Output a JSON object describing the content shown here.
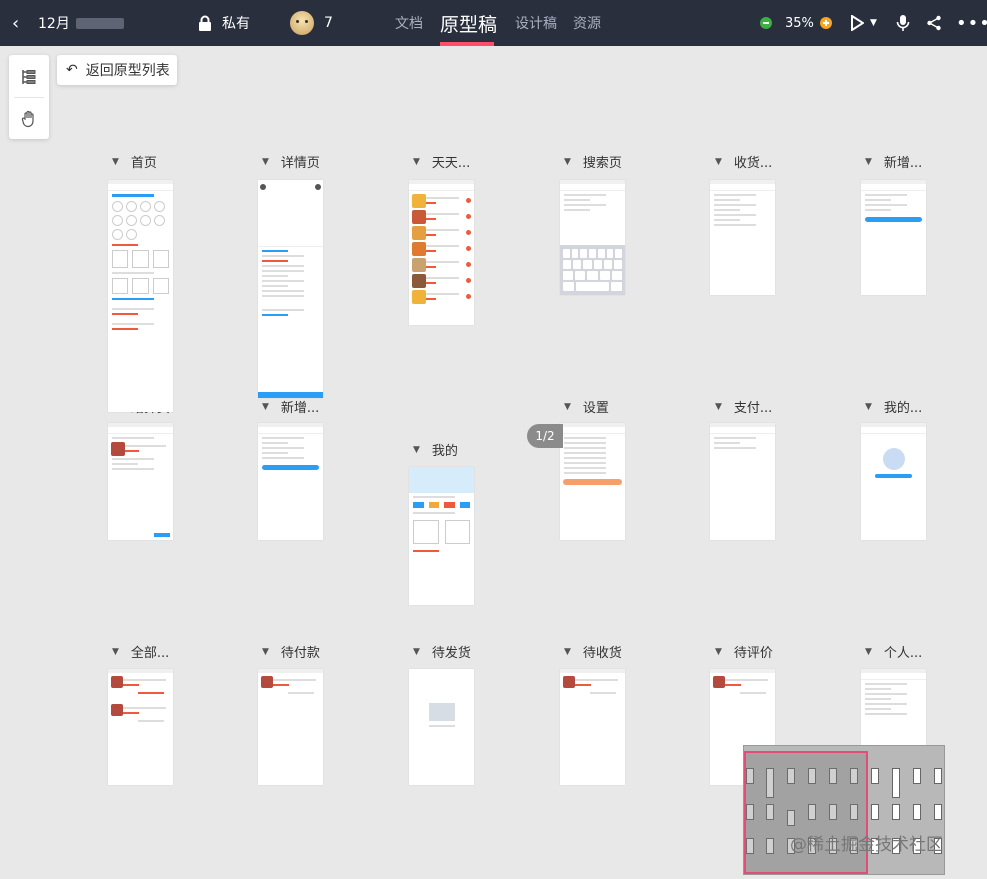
{
  "header": {
    "back_icon": "chevron-left-icon",
    "project_title": "12月",
    "privacy_label": "私有",
    "member_count": "7",
    "tabs": [
      {
        "label": "文档",
        "active": false
      },
      {
        "label": "原型稿",
        "active": true
      },
      {
        "label": "设计稿",
        "active": false
      },
      {
        "label": "资源",
        "active": false
      }
    ],
    "zoom": "35%",
    "accent": "#ff4d6a",
    "zoom_out_color": "#3cb043",
    "zoom_in_color": "#f5a623"
  },
  "toolbar": {
    "tools": [
      {
        "icon": "layer-tree-icon"
      },
      {
        "icon": "hand-icon"
      }
    ],
    "back_label": "返回原型列表"
  },
  "pager": "1/2",
  "screens": [
    {
      "label": "首页"
    },
    {
      "label": "详情页"
    },
    {
      "label": "天天..."
    },
    {
      "label": "搜索页"
    },
    {
      "label": "收货..."
    },
    {
      "label": "新增..."
    },
    {
      "label": "结算页"
    },
    {
      "label": "新增..."
    },
    {
      "label": "我的"
    },
    {
      "label": "设置"
    },
    {
      "label": "支付..."
    },
    {
      "label": "我的..."
    },
    {
      "label": "全部..."
    },
    {
      "label": "待付款"
    },
    {
      "label": "待发货"
    },
    {
      "label": "待收货"
    },
    {
      "label": "待评价"
    },
    {
      "label": "个人..."
    }
  ],
  "watermark": "@稀土掘金技术社区"
}
